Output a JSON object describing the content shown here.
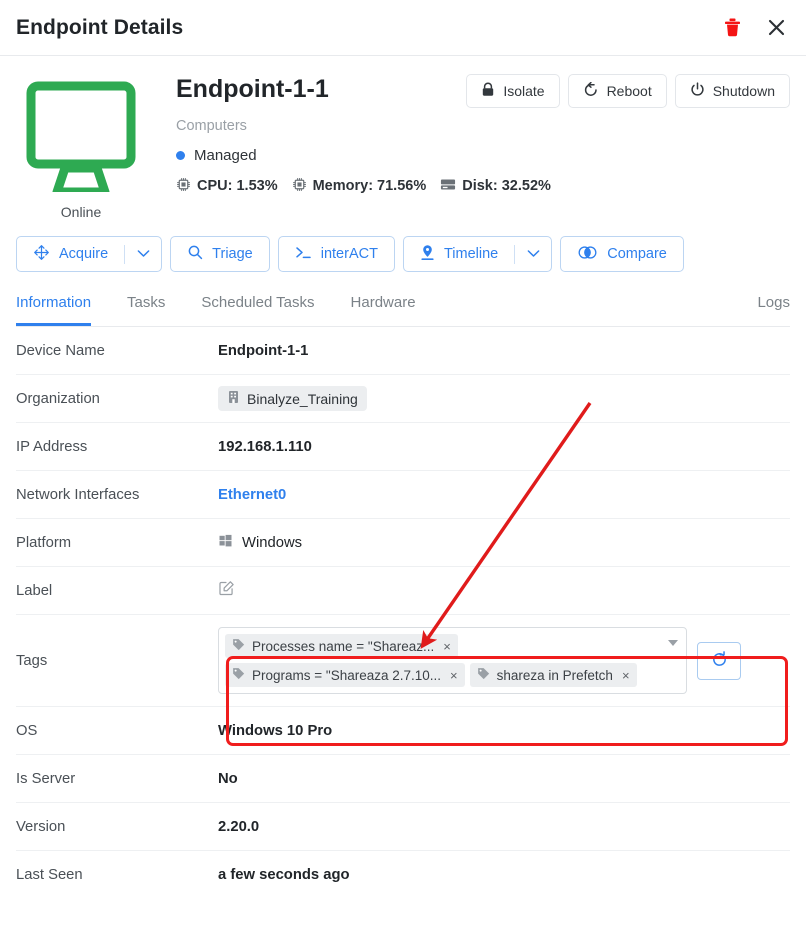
{
  "window": {
    "title": "Endpoint Details",
    "delete_icon": "trash-icon",
    "close_icon": "close-icon",
    "accent_color": "#2f80ed",
    "danger_color": "#f01d1d",
    "online_color": "#2eaa52"
  },
  "device": {
    "status_label": "Online",
    "name": "Endpoint-1-1",
    "group": "Computers",
    "managed_label": "Managed",
    "metrics": [
      {
        "icon": "cpu-icon",
        "label": "CPU: 1.53%"
      },
      {
        "icon": "memory-icon",
        "label": "Memory: 71.56%"
      },
      {
        "icon": "disk-icon",
        "label": "Disk: 32.52%"
      }
    ]
  },
  "top_actions": [
    {
      "icon": "lock-icon",
      "label": "Isolate"
    },
    {
      "icon": "reboot-icon",
      "label": "Reboot"
    },
    {
      "icon": "power-icon",
      "label": "Shutdown"
    }
  ],
  "action_buttons": [
    {
      "icon": "acquire-icon",
      "label": "Acquire",
      "has_caret": true
    },
    {
      "icon": "search-icon",
      "label": "Triage",
      "has_caret": false
    },
    {
      "icon": "terminal-icon",
      "label": "interACT",
      "has_caret": false
    },
    {
      "icon": "pin-icon",
      "label": "Timeline",
      "has_caret": true
    },
    {
      "icon": "compare-icon",
      "label": "Compare",
      "has_caret": false
    }
  ],
  "tabs": {
    "left": [
      {
        "label": "Information",
        "active": true
      },
      {
        "label": "Tasks",
        "active": false
      },
      {
        "label": "Scheduled Tasks",
        "active": false
      },
      {
        "label": "Hardware",
        "active": false
      }
    ],
    "right": {
      "label": "Logs",
      "active": false
    }
  },
  "info": {
    "device_name": {
      "label": "Device Name",
      "value": "Endpoint-1-1"
    },
    "organization": {
      "label": "Organization",
      "value": "Binalyze_Training",
      "icon": "building-icon"
    },
    "ip_address": {
      "label": "IP Address",
      "value": "192.168.1.110"
    },
    "network_interfaces": {
      "label": "Network Interfaces",
      "value": "Ethernet0"
    },
    "platform": {
      "label": "Platform",
      "value": "Windows",
      "icon": "windows-icon"
    },
    "label": {
      "label": "Label",
      "value": "",
      "icon": "edit-icon"
    },
    "tags": {
      "label": "Tags",
      "chips": [
        {
          "icon": "tag-icon",
          "text": "Processes name = \"Shareaz...",
          "remove": "×"
        },
        {
          "icon": "tag-icon",
          "text": "Programs = \"Shareaza 2.7.10...",
          "remove": "×"
        },
        {
          "icon": "tag-icon",
          "text": "shareza in Prefetch",
          "remove": "×"
        }
      ],
      "refresh_icon": "refresh-icon",
      "dropdown_icon": "chevron-down-icon"
    },
    "os": {
      "label": "OS",
      "value": "Windows 10 Pro"
    },
    "is_server": {
      "label": "Is Server",
      "value": "No"
    },
    "version": {
      "label": "Version",
      "value": "2.20.0"
    },
    "last_seen": {
      "label": "Last Seen",
      "value": "a few seconds ago"
    }
  }
}
